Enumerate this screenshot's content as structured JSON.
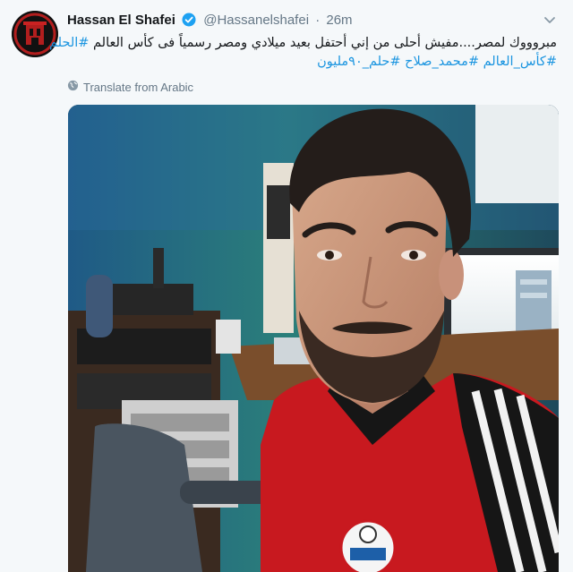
{
  "tweet": {
    "author_name": "Hassan El Shafei",
    "handle": "@Hassanelshafei",
    "separator": "·",
    "time": "26m",
    "verified": true,
    "text_line1_main": "مبروووك لمصر....مفيش أحلى من إني أحتفل بعيد ميلادي ومصر رسمياً فى كأس العالم",
    "text_line1_tag": "#الحلم",
    "text_line2_tags": [
      "#كأس_العالم",
      "#محمد_صلاح",
      "#حلم_٩٠مليون"
    ],
    "translate_label": "Translate from Arabic",
    "colors": {
      "link": "#1b95e0",
      "secondary": "#657786",
      "verified": "#1da1f2",
      "background": "#f5f8fa"
    }
  },
  "icons": {
    "verified": "verified-badge-icon",
    "caret": "chevron-down-icon",
    "globe": "globe-icon"
  }
}
